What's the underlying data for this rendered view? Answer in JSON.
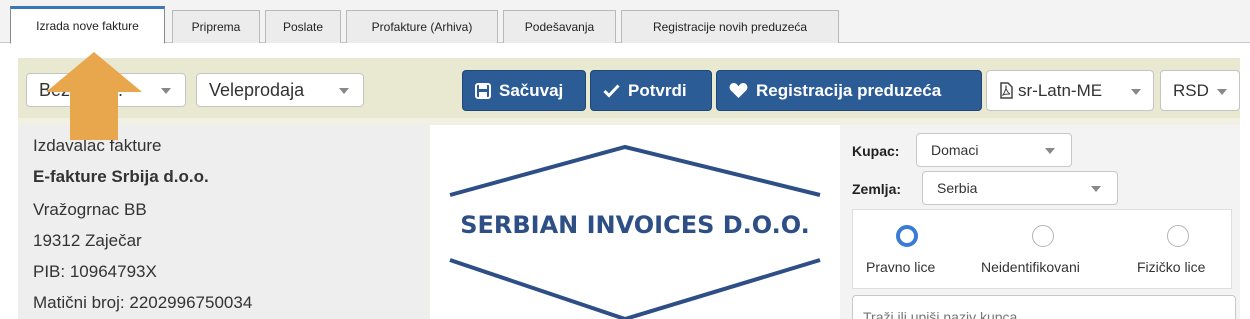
{
  "tabs": [
    {
      "label": "Izrada nove fakture",
      "active": true
    },
    {
      "label": "Priprema",
      "active": false
    },
    {
      "label": "Poslate",
      "active": false
    },
    {
      "label": "Profakture (Arhiva)",
      "active": false
    },
    {
      "label": "Podešavanja",
      "active": false
    },
    {
      "label": "Registracije novih preduzeća",
      "active": false
    }
  ],
  "toolbar": {
    "type_select_value": "Bez povi...",
    "sales_select_value": "Veleprodaja",
    "save_label": "Sačuvaj",
    "confirm_label": "Potvrdi",
    "register_label": "Registracija preduzeća",
    "locale_select_value": "sr-Latn-ME",
    "currency_select_value": "RSD"
  },
  "issuer": {
    "heading": "Izdavalac fakture",
    "company": "E-fakture Srbija d.o.o.",
    "street": "Vražogrnac BB",
    "city": "19312 Zaječar",
    "pib": "PIB: 10964793X",
    "mb": "Matični broj: 2202996750034"
  },
  "logo": {
    "text": "SERBIAN INVOICES D.O.O.",
    "color": "#2d4f85"
  },
  "buyer": {
    "kupac_label": "Kupac:",
    "kupac_value": "Domaci",
    "zemlja_label": "Zemlja:",
    "zemlja_value": "Serbia",
    "radio_options": [
      "Pravno lice",
      "Neidentifikovani",
      "Fizičko lice"
    ],
    "selected_radio": "Pravno lice",
    "search_placeholder": "Traži ili upiši naziv kupca"
  },
  "colors": {
    "accent": "#2c5c96",
    "arrow": "#e8a64d",
    "panel": "#e9e9d2"
  }
}
